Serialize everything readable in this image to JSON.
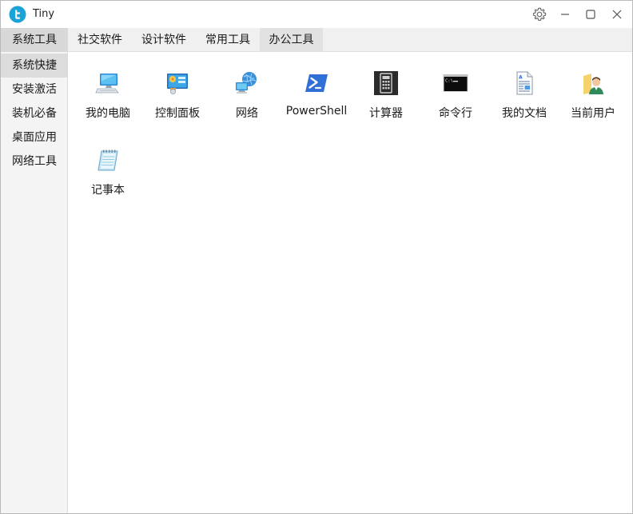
{
  "window": {
    "title": "Tiny"
  },
  "top_tabs": [
    {
      "label": "系统工具"
    },
    {
      "label": "社交软件"
    },
    {
      "label": "设计软件"
    },
    {
      "label": "常用工具"
    },
    {
      "label": "办公工具"
    }
  ],
  "sidebar": {
    "items": [
      {
        "label": "系统快捷"
      },
      {
        "label": "安装激活"
      },
      {
        "label": "装机必备"
      },
      {
        "label": "桌面应用"
      },
      {
        "label": "网络工具"
      }
    ]
  },
  "apps": [
    {
      "label": "我的电脑",
      "icon": "computer-icon"
    },
    {
      "label": "控制面板",
      "icon": "control-panel-icon"
    },
    {
      "label": "网络",
      "icon": "network-icon"
    },
    {
      "label": "PowerShell",
      "icon": "powershell-icon"
    },
    {
      "label": "计算器",
      "icon": "calculator-icon"
    },
    {
      "label": "命令行",
      "icon": "command-prompt-icon"
    },
    {
      "label": "我的文档",
      "icon": "document-icon"
    },
    {
      "label": "当前用户",
      "icon": "user-folder-icon"
    },
    {
      "label": "记事本",
      "icon": "notepad-icon"
    }
  ],
  "colors": {
    "accent": "#1aa3d6",
    "tab_active": "#d8d8d8",
    "sidebar_active": "#dcdcdc"
  }
}
